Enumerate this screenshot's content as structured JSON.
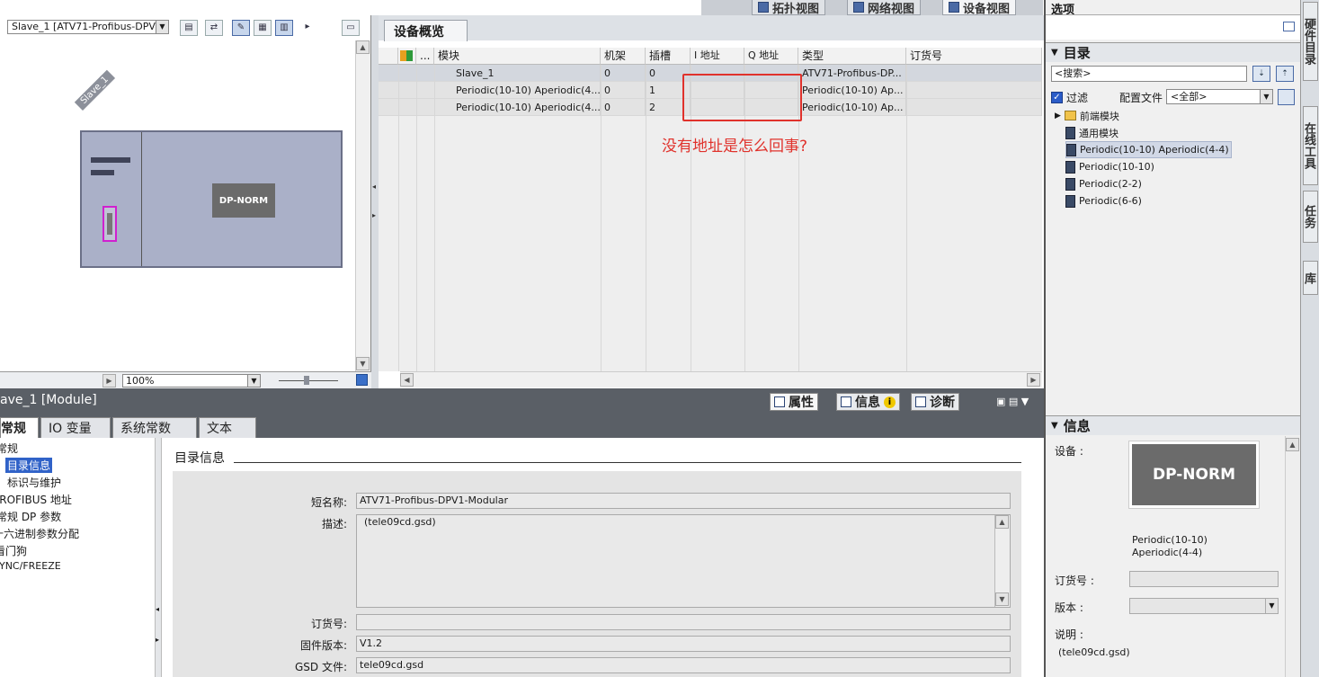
{
  "view_tabs": [
    {
      "label": "拓扑视图",
      "icon": "topology-icon"
    },
    {
      "label": "网络视图",
      "icon": "network-icon"
    },
    {
      "label": "设备视图",
      "icon": "device-icon"
    }
  ],
  "device_view": {
    "device_select": "Slave_1 [ATV71-Profibus-DPV1",
    "slave_label": "Slave_1",
    "module_label": "DP-NORM",
    "zoom": "100%"
  },
  "overview": {
    "tab": "设备概览",
    "columns": [
      "...",
      "模块",
      "机架",
      "插槽",
      "I 地址",
      "Q 地址",
      "类型",
      "订货号"
    ],
    "rows": [
      {
        "module": "Slave_1",
        "rack": "0",
        "slot": "0",
        "i_addr": "",
        "q_addr": "",
        "type": "ATV71-Profibus-DP...",
        "order": ""
      },
      {
        "module": "Periodic(10-10) Aperiodic(4...",
        "rack": "0",
        "slot": "1",
        "i_addr": "",
        "q_addr": "",
        "type": "Periodic(10-10) Ap...",
        "order": ""
      },
      {
        "module": "Periodic(10-10) Aperiodic(4...",
        "rack": "0",
        "slot": "2",
        "i_addr": "",
        "q_addr": "",
        "type": "Periodic(10-10) Ap...",
        "order": ""
      }
    ],
    "annotation": "没有地址是怎么回事?",
    "annotation_color": "#e0322c"
  },
  "right_panel": {
    "title": "选项",
    "catalog_title": "目录",
    "search_placeholder": "<搜索>",
    "filter_label": "过滤",
    "profile_label": "配置文件",
    "profile_value": "<全部>",
    "items": [
      {
        "label": "前端模块",
        "icon": "folder-icon"
      },
      {
        "label": "通用模块",
        "icon": "module-icon"
      },
      {
        "label": "Periodic(10-10) Aperiodic(4-4)",
        "icon": "module-icon",
        "selected": true
      },
      {
        "label": "Periodic(10-10)",
        "icon": "module-icon"
      },
      {
        "label": "Periodic(2-2)",
        "icon": "module-icon"
      },
      {
        "label": "Periodic(6-6)",
        "icon": "module-icon"
      }
    ],
    "info_title": "信息",
    "device_label": "设备 :",
    "device_image_text": "DP-NORM",
    "device_name_line1": "Periodic(10-10)",
    "device_name_line2": "Aperiodic(4-4)",
    "order_label": "订货号 :",
    "version_label": "版本 :",
    "desc_label": "说明 :",
    "desc_value": "(tele09cd.gsd)"
  },
  "side_tabs": [
    "硬件目录",
    "在线工具",
    "任务",
    "库"
  ],
  "inspector": {
    "title": "ave_1 [Module]",
    "tabs": [
      {
        "label": "属性",
        "icon": "properties-icon"
      },
      {
        "label": "信息",
        "icon": "info-icon"
      },
      {
        "label": "诊断",
        "icon": "diagnostics-icon"
      }
    ],
    "prop_tabs": [
      "常规",
      "IO 变量",
      "系统常数",
      "文本"
    ],
    "nav": [
      "常规",
      "目录信息",
      "标识与维护",
      "PROFIBUS 地址",
      "常规 DP 参数",
      "十六进制参数分配",
      "看门狗",
      "SYNC/FREEZE"
    ],
    "section_title": "目录信息",
    "fields": [
      {
        "label": "短名称:",
        "value": "ATV71-Profibus-DPV1-Modular"
      },
      {
        "label": "描述:",
        "value": "(tele09cd.gsd)"
      },
      {
        "label": "订货号:",
        "value": ""
      },
      {
        "label": "固件版本:",
        "value": "V1.2"
      },
      {
        "label": "GSD 文件:",
        "value": "tele09cd.gsd"
      }
    ]
  }
}
